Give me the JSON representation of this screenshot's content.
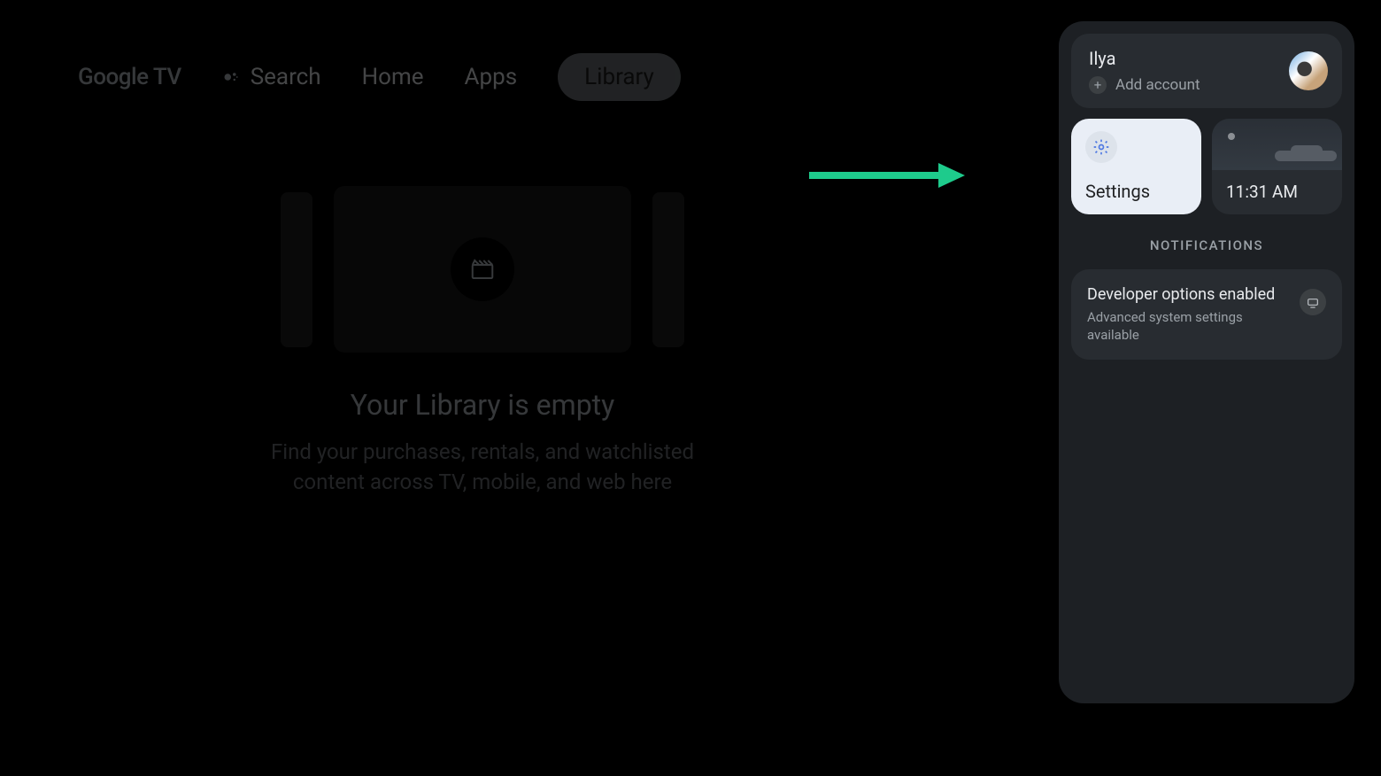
{
  "header": {
    "logo": "Google TV",
    "nav": {
      "search": "Search",
      "home": "Home",
      "apps": "Apps",
      "library": "Library"
    }
  },
  "library": {
    "empty_title": "Your Library is empty",
    "empty_subtitle": "Find your purchases, rentals, and watchlisted content across TV, mobile, and web here"
  },
  "panel": {
    "account": {
      "name": "Ilya",
      "add_account_label": "Add account"
    },
    "settings_label": "Settings",
    "time": "11:31 AM",
    "notifications_header": "NOTIFICATIONS",
    "notifications": [
      {
        "title": "Developer options enabled",
        "subtitle": "Advanced system settings available"
      }
    ]
  },
  "colors": {
    "accent_arrow": "#1ecb8c",
    "settings_icon": "#4f79e2"
  }
}
